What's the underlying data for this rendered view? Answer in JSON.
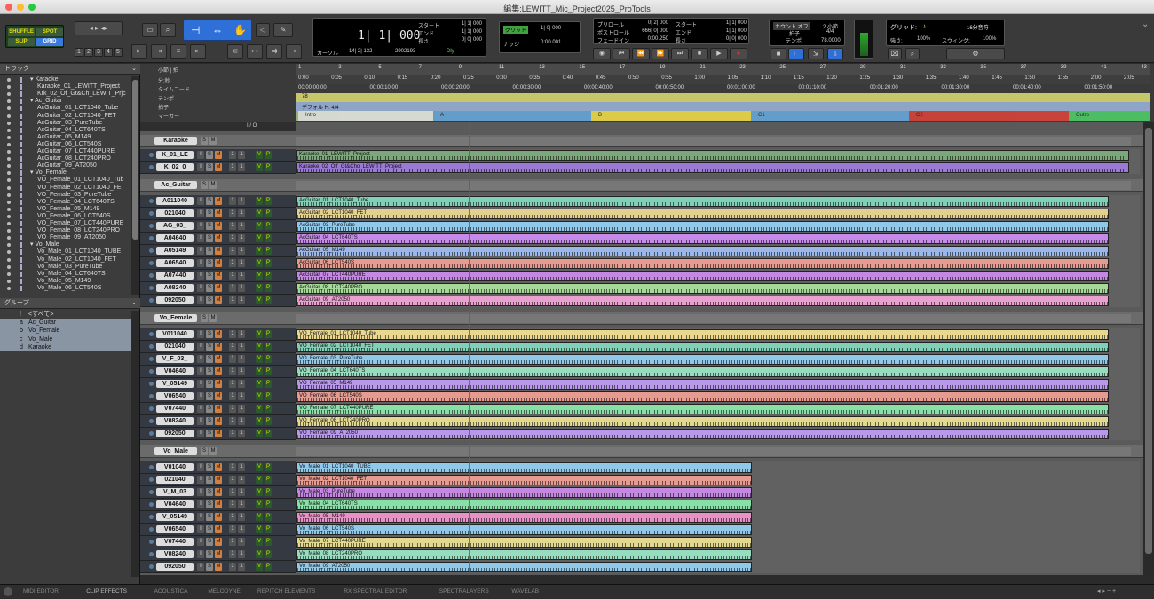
{
  "window": {
    "title": "編集:LEWITT_Mic_Project2025_ProTools"
  },
  "toolbar": {
    "modes": [
      "SHUFFLE",
      "SPOT",
      "SLIP",
      "GRID"
    ],
    "zoom_presets": [
      "1",
      "2",
      "3",
      "4",
      "5"
    ],
    "counter": {
      "main": "1| 1| 000",
      "cursor_label": "カーソル",
      "cursor_value": "14| 2| 132",
      "samples": "2902193",
      "dly": "Dly"
    },
    "selection": {
      "labels": [
        "スタート",
        "エンド",
        "長さ"
      ],
      "values": [
        "1| 1| 000",
        "1| 1| 000",
        "0| 0| 000"
      ]
    },
    "grid": {
      "label": "グリッド",
      "value": "1| 0| 000",
      "nudge_label": "ナッジ",
      "nudge_value": "0:00.001"
    },
    "preroll": {
      "labels": [
        "プリロール",
        "ポストロール",
        "フェードイン"
      ],
      "values": [
        "0| 2| 000",
        "666| 0| 000",
        "0:00.250"
      ]
    },
    "transport_sel": {
      "labels": [
        "スタート",
        "エンド",
        "長さ"
      ],
      "values": [
        "1| 1| 000",
        "1| 1| 000",
        "0| 0| 000"
      ]
    },
    "tempo": {
      "count_off": "カウント オフ",
      "bars": "2 小節",
      "meter_label": "拍子",
      "meter": "4/4",
      "tempo_label": "テンポ",
      "tempo_value": "78.0000"
    },
    "grid_settings": {
      "label": "グリッド:",
      "value": "16分音符",
      "strength_label": "強さ:",
      "strength": "100%",
      "swing_label": "スウィング:",
      "swing": "100%"
    }
  },
  "left": {
    "tracks_header": "トラック",
    "track_list": [
      {
        "name": "Karaoke",
        "folder": true,
        "indent": 0
      },
      {
        "name": "Karaoke_01_LEWITT_Project",
        "indent": 1
      },
      {
        "name": "Krk_02_Of_Gt&Ch_LEWIT_Prjc",
        "indent": 1
      },
      {
        "name": "Ac_Guitar",
        "folder": true,
        "indent": 0
      },
      {
        "name": "AcGuitar_01_LCT1040_Tube",
        "indent": 1
      },
      {
        "name": "AcGuitar_02_LCT1040_FET",
        "indent": 1
      },
      {
        "name": "AcGuitar_03_PureTube",
        "indent": 1
      },
      {
        "name": "AcGuitar_04_LCT640TS",
        "indent": 1
      },
      {
        "name": "AcGuitar_05_M149",
        "indent": 1
      },
      {
        "name": "AcGuitar_06_LCT540S",
        "indent": 1
      },
      {
        "name": "AcGuitar_07_LCT440PURE",
        "indent": 1
      },
      {
        "name": "AcGuitar_08_LCT240PRO",
        "indent": 1
      },
      {
        "name": "AcGuitar_09_AT2050",
        "indent": 1
      },
      {
        "name": "Vo_Female",
        "folder": true,
        "indent": 0
      },
      {
        "name": "VO_Female_01_LCT1040_Tub",
        "indent": 1
      },
      {
        "name": "VO_Female_02_LCT1040_FET",
        "indent": 1
      },
      {
        "name": "VO_Female_03_PureTube",
        "indent": 1
      },
      {
        "name": "VO_Female_04_LCT640TS",
        "indent": 1
      },
      {
        "name": "VO_Female_05_M149",
        "indent": 1
      },
      {
        "name": "VO_Female_06_LCT540S",
        "indent": 1
      },
      {
        "name": "VO_Female_07_LCT440PURE",
        "indent": 1
      },
      {
        "name": "VO_Female_08_LCT240PRO",
        "indent": 1
      },
      {
        "name": "VO_Female_09_AT2050",
        "indent": 1
      },
      {
        "name": "Vo_Male",
        "folder": true,
        "indent": 0
      },
      {
        "name": "Vo_Male_01_LCT1040_TUBE",
        "indent": 1
      },
      {
        "name": "Vo_Male_02_LCT1040_FET",
        "indent": 1
      },
      {
        "name": "Vo_Male_03_PureTube",
        "indent": 1
      },
      {
        "name": "Vo_Male_04_LCT640TS",
        "indent": 1
      },
      {
        "name": "Vo_Male_05_M149",
        "indent": 1
      },
      {
        "name": "Vo_Male_06_LCT540S",
        "indent": 1
      }
    ],
    "groups_header": "グループ",
    "groups": [
      {
        "letter": "!",
        "name": "<すべて>"
      },
      {
        "letter": "a",
        "name": "Ac_Guitar"
      },
      {
        "letter": "b",
        "name": "Vo_Female"
      },
      {
        "letter": "c",
        "name": "Vo_Male"
      },
      {
        "letter": "d",
        "name": "Karaoke"
      }
    ]
  },
  "rulers": {
    "labels": [
      "小節 | 拍",
      "分:秒",
      "タイムコード",
      "テンポ",
      "拍子",
      "マーカー"
    ],
    "bars": [
      "1",
      "3",
      "5",
      "7",
      "9",
      "11",
      "13",
      "15",
      "17",
      "19",
      "21",
      "23",
      "25",
      "27",
      "29",
      "31",
      "33",
      "35",
      "37",
      "39",
      "41",
      "43"
    ],
    "minsec": [
      "0:00",
      "0:05",
      "0:10",
      "0:15",
      "0:20",
      "0:25",
      "0:30",
      "0:35",
      "0:40",
      "0:45",
      "0:50",
      "0:55",
      "1:00",
      "1:05",
      "1:10",
      "1:15",
      "1:20",
      "1:25",
      "1:30",
      "1:35",
      "1:40",
      "1:45",
      "1:50",
      "1:55",
      "2:00",
      "2:05"
    ],
    "timecode": [
      "00:00:00:00",
      "00:00:10:00",
      "00:00:20:00",
      "00:00:30:00",
      "00:00:40:00",
      "00:00:50:00",
      "00:01:00:00",
      "00:01:10:00",
      "00:01:20:00",
      "00:01:30:00",
      "00:01:40:00",
      "00:01:50:00",
      "00:02:00:00"
    ],
    "tempo_value": "78",
    "meter_text": "デフォルト: 4/4",
    "markers": [
      {
        "name": "Intro",
        "color": "#e0e0e0"
      },
      {
        "name": "A",
        "color": "#5a9ad8"
      },
      {
        "name": "B",
        "color": "#e8d040"
      },
      {
        "name": "C1",
        "color": "#5a9ad8"
      },
      {
        "name": "C2",
        "color": "#d03030"
      },
      {
        "name": "Outro",
        "color": "#40c060"
      }
    ],
    "io_label": "I / O"
  },
  "folders": [
    {
      "name": "Karaoke",
      "tracks": [
        {
          "short": "K_01_LE",
          "clip": "Karaoke_01_LEWITT_Project",
          "color": "#7ba77a",
          "end": 1273
        },
        {
          "short": "K_02_0",
          "clip": "Karaoke_02_Off_Gt&Cho_LEWITT_Project",
          "color": "#9b79d6",
          "end": 1273
        }
      ]
    },
    {
      "name": "Ac_Guitar",
      "tracks": [
        {
          "short": "A011040",
          "clip": "AcGuitar_01_LCT1040_Tube",
          "color": "#7fd0b6",
          "end": 1250
        },
        {
          "short": "021040",
          "clip": "AcGuitar_02_LCT1040_FET",
          "color": "#e2d08f",
          "end": 1250
        },
        {
          "short": "AG_03_",
          "clip": "AcGuitar_03_PureTube",
          "color": "#90c8ea",
          "end": 1250
        },
        {
          "short": "A04640",
          "clip": "AcGuitar_04_LCT640TS",
          "color": "#c68ae8",
          "end": 1250
        },
        {
          "short": "A05149",
          "clip": "AcGuitar_05_M149",
          "color": "#9bb6e8",
          "end": 1250
        },
        {
          "short": "A06540",
          "clip": "AcGuitar_06_LCT540S",
          "color": "#e69a90",
          "end": 1250
        },
        {
          "short": "A07440",
          "clip": "AcGuitar_07_LCT440PURE",
          "color": "#c488e2",
          "end": 1250
        },
        {
          "short": "A08240",
          "clip": "AcGuitar_08_LCT240PRO",
          "color": "#a6d89a",
          "end": 1250
        },
        {
          "short": "092050",
          "clip": "AcGuitar_09_AT2050",
          "color": "#e8a0cf",
          "end": 1250
        }
      ]
    },
    {
      "name": "Vo_Female",
      "tracks": [
        {
          "short": "V011040",
          "clip": "VO_Female_01_LCT1040_Tube",
          "color": "#ead890",
          "end": 1250
        },
        {
          "short": "021040",
          "clip": "VO_Female_02_LCT1040_FET",
          "color": "#7fd0b6",
          "end": 1250
        },
        {
          "short": "V_F_03_",
          "clip": "VO_Female_03_PureTube",
          "color": "#90c8ea",
          "end": 1250
        },
        {
          "short": "V04640",
          "clip": "VO_Female_04_LCT640TS",
          "color": "#98dcc0",
          "end": 1250
        },
        {
          "short": "V_05149",
          "clip": "VO_Female_05_M149",
          "color": "#b898e8",
          "end": 1250
        },
        {
          "short": "V06540",
          "clip": "VO_Female_06_LCT540S",
          "color": "#e69a90",
          "end": 1250
        },
        {
          "short": "V07440",
          "clip": "VO_Female_07_LCT440PURE",
          "color": "#88e0a8",
          "end": 1250
        },
        {
          "short": "V08240",
          "clip": "VO_Female_08_LCT240PRO",
          "color": "#e2d890",
          "end": 1250
        },
        {
          "short": "092050",
          "clip": "VO_Female_09_AT2050",
          "color": "#b898e8",
          "end": 1250
        }
      ]
    },
    {
      "name": "Vo_Male",
      "tracks": [
        {
          "short": "V01040",
          "clip": "Vo_Male_01_LCT1040_TUBE",
          "color": "#90c8ea",
          "end": 848
        },
        {
          "short": "021040",
          "clip": "Vo_Male_02_LCT1040_FET",
          "color": "#e69a90",
          "end": 848
        },
        {
          "short": "V_M_03",
          "clip": "Vo_Male_03_PureTube",
          "color": "#c488e2",
          "end": 848
        },
        {
          "short": "V04640",
          "clip": "Vo_Male_04_LCT640TS",
          "color": "#88e0a8",
          "end": 848
        },
        {
          "short": "V_05149",
          "clip": "Vo_Male_05_M149",
          "color": "#e890c8",
          "end": 848
        },
        {
          "short": "V06540",
          "clip": "Vo_Male_06_LCT540S",
          "color": "#90c8ea",
          "end": 848
        },
        {
          "short": "V07440",
          "clip": "Vo_Male_07_LCT440PURE",
          "color": "#e2d890",
          "end": 848
        },
        {
          "short": "V08240",
          "clip": "Vo_Male_08_LCT240PRO",
          "color": "#98dcc0",
          "end": 848
        },
        {
          "short": "092050",
          "clip": "Vo_Male_09_AT2050",
          "color": "#90c8ea",
          "end": 848
        }
      ]
    }
  ],
  "bottom_tabs": [
    "MIDI EDITOR",
    "CLIP EFFECTS",
    "ACOUSTICA",
    "MELODYNE",
    "REPITCH ELEMENTS",
    "RX SPECTRAL EDITOR",
    "SPECTRALAYERS",
    "WAVELAB"
  ]
}
